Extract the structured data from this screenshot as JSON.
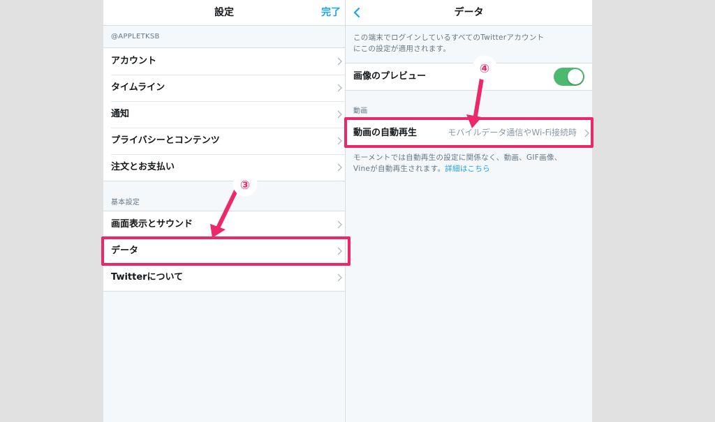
{
  "left_panel": {
    "title": "設定",
    "done_label": "完了",
    "account_header": "@APPLETKSB",
    "account_items": [
      "アカウント",
      "タイムライン",
      "通知",
      "プライバシーとコンテンツ",
      "注文とお支払い"
    ],
    "basic_header": "基本設定",
    "basic_items": [
      "画面表示とサウンド",
      "データ",
      "Twitterについて"
    ]
  },
  "right_panel": {
    "title": "データ",
    "intro_line1": "この端末でログインしているすべてのTwitterアカウント",
    "intro_line2": "にこの設定が適用されます。",
    "image_preview_label": "画像のプレビュー",
    "image_preview_enabled": true,
    "video_header": "動画",
    "autoplay_label": "動画の自動再生",
    "autoplay_value": "モバイルデータ通信やWi-Fi接続時",
    "note_line1": "モーメントでは自動再生の設定に関係なく、動画、GIF画像、",
    "note_line2_prefix": "Vineが自動再生されます。",
    "note_link": "詳細はこちら"
  },
  "annotations": {
    "step3_label": "③",
    "step4_label": "④"
  },
  "colors": {
    "accent": "#1da1f2",
    "toggle_on": "#4cb96e",
    "highlight": "#ec2869",
    "background": "#f5f8fa",
    "outside": "#e1e1e1"
  },
  "icons": {
    "row_disclosure": "chevron-right-icon",
    "nav_back": "chevron-left-icon"
  }
}
